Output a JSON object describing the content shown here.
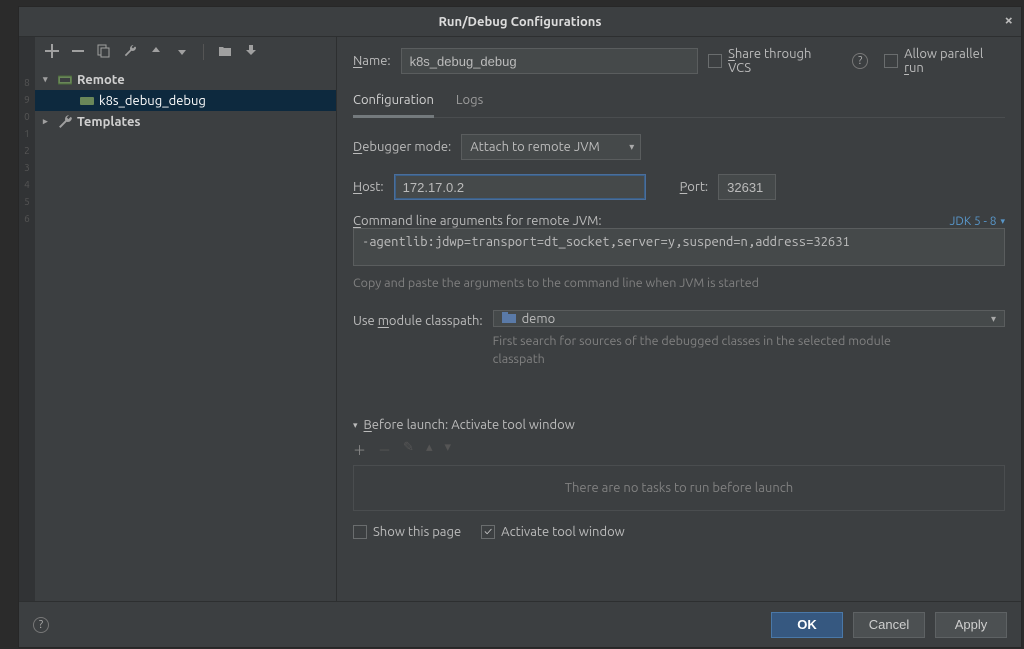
{
  "window": {
    "title": "Run/Debug Configurations"
  },
  "tree": {
    "remote": "Remote",
    "item": "k8s_debug_debug",
    "templates": "Templates"
  },
  "header": {
    "name_label": "Name:",
    "name_value": "k8s_debug_debug",
    "share_label": "Share through VCS",
    "allow_parallel": "Allow parallel run"
  },
  "tabs": {
    "configuration": "Configuration",
    "logs": "Logs"
  },
  "config": {
    "debugger_label": "Debugger mode:",
    "debugger_value": "Attach to remote JVM",
    "host_label": "Host:",
    "host_value": "172.17.0.2",
    "port_label": "Port:",
    "port_value": "32631",
    "cmd_label": "Command line arguments for remote JVM:",
    "jdk_label": "JDK 5 - 8",
    "cmd_value": "-agentlib:jdwp=transport=dt_socket,server=y,suspend=n,address=32631",
    "cmd_hint": "Copy and paste the arguments to the command line when JVM is started",
    "module_label": "Use module classpath:",
    "module_value": "demo",
    "module_hint": "First search for sources of the debugged classes in the selected module classpath"
  },
  "before": {
    "title": "Before launch: Activate tool window",
    "empty": "There are no tasks to run before launch",
    "show_page": "Show this page",
    "activate": "Activate tool window"
  },
  "buttons": {
    "ok": "OK",
    "cancel": "Cancel",
    "apply": "Apply"
  }
}
